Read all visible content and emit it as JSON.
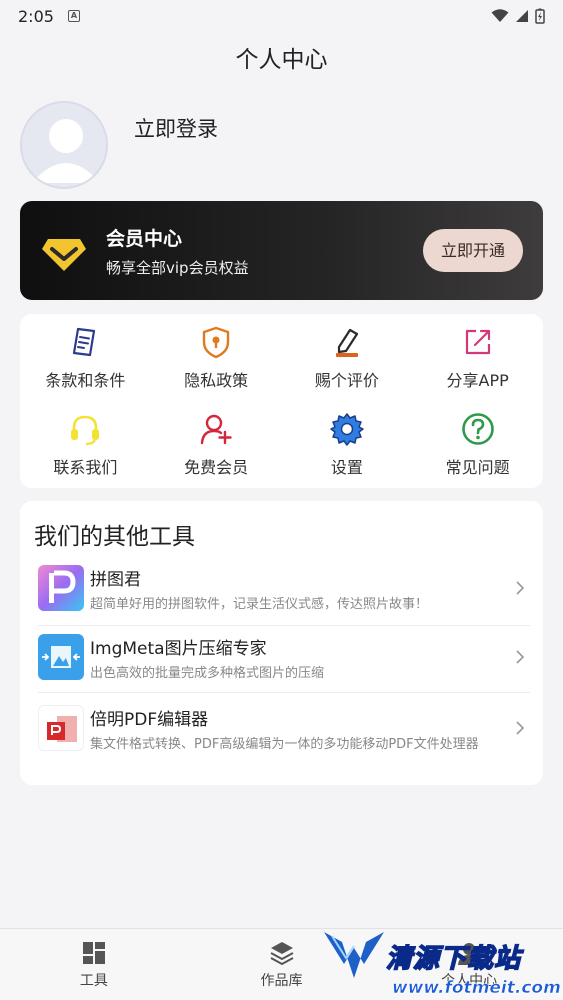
{
  "status_bar": {
    "time": "2:05",
    "indicator": "A"
  },
  "header": {
    "title": "个人中心"
  },
  "profile": {
    "login_label": "立即登录"
  },
  "vip": {
    "title": "会员中心",
    "subtitle": "畅享全部vip会员权益",
    "button_label": "立即开通",
    "accent_color": "#f2c530"
  },
  "grid": {
    "items": [
      {
        "label": "条款和条件",
        "icon": "document-icon",
        "color": "#2b3a8c"
      },
      {
        "label": "隐私政策",
        "icon": "shield-lock-icon",
        "color": "#e07a1c"
      },
      {
        "label": "赐个评价",
        "icon": "pencil-icon",
        "color": "#e0601c"
      },
      {
        "label": "分享APP",
        "icon": "share-out-icon",
        "color": "#d6377a"
      },
      {
        "label": "联系我们",
        "icon": "headset-icon",
        "color": "#f2e234"
      },
      {
        "label": "免费会员",
        "icon": "user-add-icon",
        "color": "#d6253a"
      },
      {
        "label": "设置",
        "icon": "gear-icon",
        "color": "#1f6fd6"
      },
      {
        "label": "常见问题",
        "icon": "question-icon",
        "color": "#2e9a4a"
      }
    ]
  },
  "tools": {
    "title": "我们的其他工具",
    "items": [
      {
        "name": "拼图君",
        "desc": "超简单好用的拼图软件，记录生活仪式感，传达照片故事！",
        "icon": "collage-app-icon"
      },
      {
        "name": "ImgMeta图片压缩专家",
        "desc": "出色高效的批量完成多种格式图片的压缩",
        "icon": "image-compress-app-icon"
      },
      {
        "name": "倍明PDF编辑器",
        "desc": "集文件格式转换、PDF高级编辑为一体的多功能移动PDF文件处理器",
        "icon": "pdf-editor-app-icon"
      }
    ]
  },
  "bottom_nav": {
    "items": [
      {
        "label": "工具",
        "icon": "grid-tools-icon"
      },
      {
        "label": "作品库",
        "icon": "layers-icon"
      },
      {
        "label": "个人中心",
        "icon": "user-icon"
      }
    ]
  },
  "watermark": {
    "title": "清源下载站",
    "url": "www.fotmeit.com"
  }
}
